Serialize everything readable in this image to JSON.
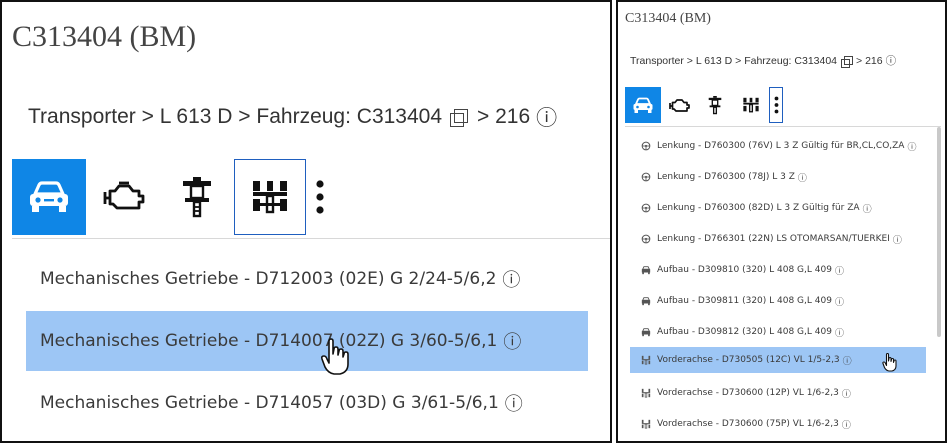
{
  "left": {
    "title": "C313404 (BM)",
    "breadcrumb": {
      "text": "Transporter > L 613 D > Fahrzeug: C313404",
      "suffix": "> 216",
      "info": "ⓘ"
    },
    "toolbar": [
      {
        "name": "vehicle-icon",
        "active": true
      },
      {
        "name": "engine-icon",
        "active": false
      },
      {
        "name": "transmission-icon",
        "active": false
      },
      {
        "name": "axle-icon",
        "active": false
      },
      {
        "name": "more-icon",
        "active": false
      }
    ],
    "rows": [
      {
        "label": "Mechanisches Getriebe - D712003 (02E) G 2/24-5/6,2",
        "info": "ⓘ",
        "selected": false
      },
      {
        "label": "Mechanisches Getriebe - D714007 (02Z) G 3/60-5/6,1",
        "info": "ⓘ",
        "selected": true
      },
      {
        "label": "Mechanisches Getriebe - D714057 (03D) G 3/61-5/6,1",
        "info": "ⓘ",
        "selected": false
      }
    ]
  },
  "right": {
    "title": "C313404 (BM)",
    "breadcrumb": {
      "text": "Transporter > L 613 D > Fahrzeug: C313404",
      "suffix": "> 216",
      "info": "ⓘ"
    },
    "rows": [
      {
        "icon": "steering-icon",
        "label": "Lenkung - D760300 (76V) L 3 Z Gültig für BR,CL,CO,ZA",
        "info": "ⓘ",
        "selected": false
      },
      {
        "icon": "steering-icon",
        "label": "Lenkung - D760300 (78J) L 3 Z",
        "info": "ⓘ",
        "selected": false
      },
      {
        "icon": "steering-icon",
        "label": "Lenkung - D760300 (82D) L 3 Z Gültig für ZA",
        "info": "ⓘ",
        "selected": false
      },
      {
        "icon": "steering-icon",
        "label": "Lenkung - D766301 (22N) LS OTOMARSAN/TUERKEI",
        "info": "ⓘ",
        "selected": false
      },
      {
        "icon": "body-icon",
        "label": "Aufbau - D309810 (320) L 408 G,L 409",
        "info": "ⓘ",
        "selected": false
      },
      {
        "icon": "body-icon",
        "label": "Aufbau - D309811 (320) L 408 G,L 409",
        "info": "ⓘ",
        "selected": false
      },
      {
        "icon": "body-icon",
        "label": "Aufbau - D309812 (320) L 408 G,L 409",
        "info": "ⓘ",
        "selected": false
      },
      {
        "icon": "front-axle-icon",
        "label": "Vorderachse - D730505 (12C) VL 1/5-2,3",
        "info": "ⓘ",
        "selected": true
      },
      {
        "icon": "front-axle-icon",
        "label": "Vorderachse - D730600 (12P) VL 1/6-2,3",
        "info": "ⓘ",
        "selected": false
      },
      {
        "icon": "front-axle-icon",
        "label": "Vorderachse - D730600 (75P) VL 1/6-2,3",
        "info": "ⓘ",
        "selected": false
      }
    ]
  },
  "colors": {
    "active_tab": "#0f86e6",
    "selected_row": "#9dc6f5",
    "outline": "#1f5fbf"
  }
}
